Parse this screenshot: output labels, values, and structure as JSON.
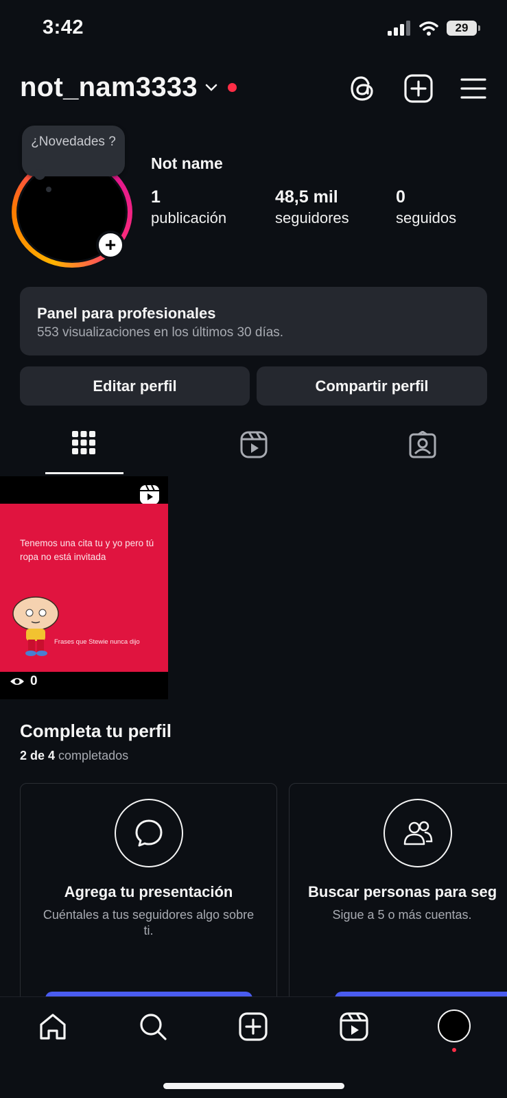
{
  "status_bar": {
    "time": "3:42",
    "battery": "29"
  },
  "header": {
    "username": "not_nam3333"
  },
  "profile": {
    "bubble_text": "¿Novedades ?",
    "display_name": "Not name",
    "stats": [
      {
        "value": "1",
        "label": "publicación"
      },
      {
        "value": "48,5 mil",
        "label": "seguidores"
      },
      {
        "value": "0",
        "label": "seguidos"
      }
    ]
  },
  "panel": {
    "title": "Panel para profesionales",
    "subtitle": "553 visualizaciones en los últimos 30 días."
  },
  "buttons": {
    "edit": "Editar perfil",
    "share": "Compartir perfil"
  },
  "post": {
    "text": "Tenemos una cita tu y yo pero tú ropa no está invitada",
    "caption": "Frases que Stewie nunca dijo",
    "views": "0"
  },
  "complete": {
    "title": "Completa tu perfil",
    "progress_bold": "2 de 4",
    "progress_rest": "completados",
    "cards": [
      {
        "title": "Agrega tu presentación",
        "subtitle": "Cuéntales a tus seguidores algo sobre ti.",
        "icon": "chat-bubble-icon"
      },
      {
        "title": "Buscar personas para seg",
        "subtitle": "Sigue a 5 o más cuentas.",
        "icon": "people-icon"
      }
    ]
  },
  "colors": {
    "background": "#0c0f14",
    "card": "#25282f",
    "accent_blue": "#4a5cf0",
    "notification_red": "#ff2d46",
    "post_pink": "#e0143f"
  }
}
